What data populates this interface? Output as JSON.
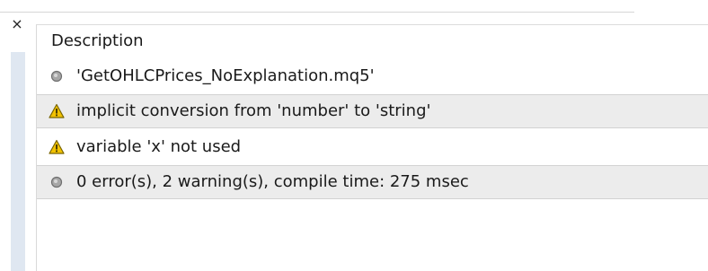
{
  "window": {
    "close_symbol": "×"
  },
  "table": {
    "header": "Description",
    "rows": [
      {
        "icon": "info-dot-icon",
        "text": "'GetOHLCPrices_NoExplanation.mq5'"
      },
      {
        "icon": "warning-icon",
        "text": "implicit conversion from 'number' to 'string'"
      },
      {
        "icon": "warning-icon",
        "text": "variable 'x' not used"
      },
      {
        "icon": "info-dot-icon",
        "text": "0 error(s), 2 warning(s), compile time: 275 msec"
      }
    ]
  },
  "colors": {
    "row_highlight": "#ececec",
    "warning_fill": "#f2c200",
    "warning_border": "#8a7100",
    "info_dot": "#9b9b9b",
    "side_strip": "#dfe7f1"
  }
}
